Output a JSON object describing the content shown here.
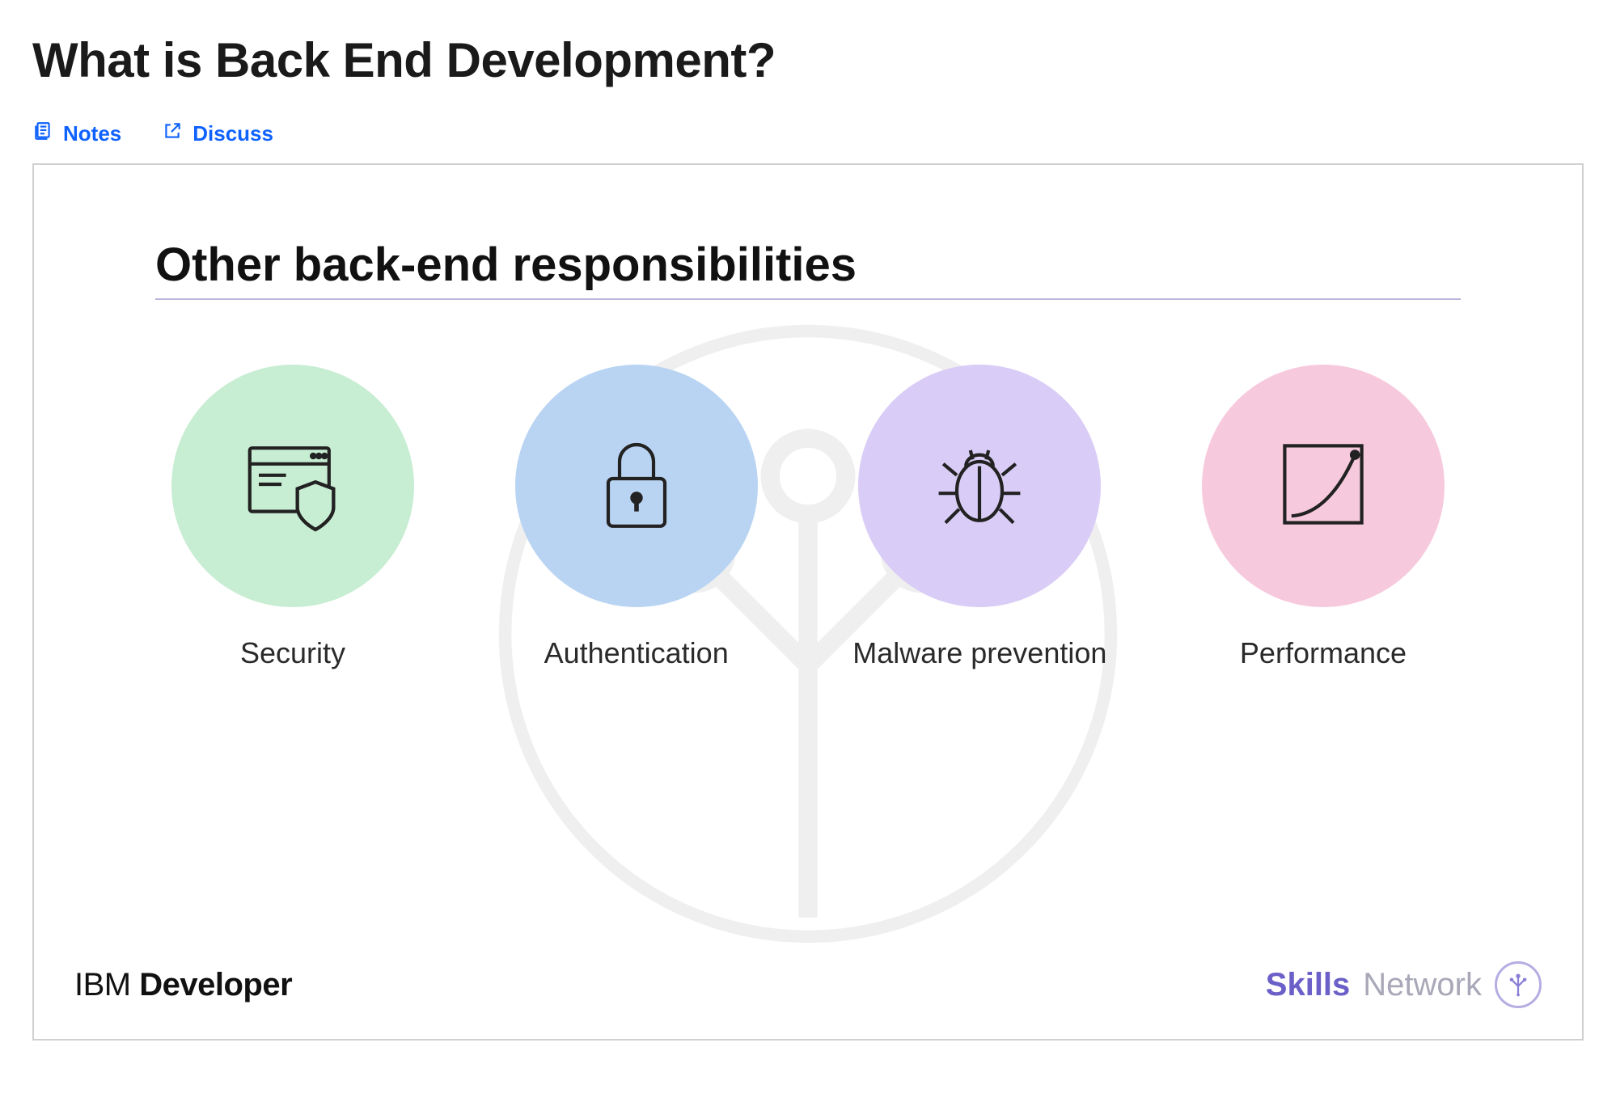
{
  "page": {
    "title": "What is Back End Development?"
  },
  "actions": {
    "notes_label": "Notes",
    "discuss_label": "Discuss"
  },
  "slide": {
    "heading": "Other back-end responsibilities",
    "items": [
      {
        "label": "Security",
        "icon": "browser-shield-icon",
        "color": "green"
      },
      {
        "label": "Authentication",
        "icon": "lock-icon",
        "color": "blue"
      },
      {
        "label": "Malware prevention",
        "icon": "bug-icon",
        "color": "purple"
      },
      {
        "label": "Performance",
        "icon": "growth-chart-icon",
        "color": "pink"
      }
    ],
    "footer": {
      "brand_light": "IBM",
      "brand_bold": "Developer",
      "right_bold": "Skills",
      "right_light": "Network"
    }
  },
  "colors": {
    "link": "#0f62fe",
    "divider": "#b8b5d9"
  }
}
